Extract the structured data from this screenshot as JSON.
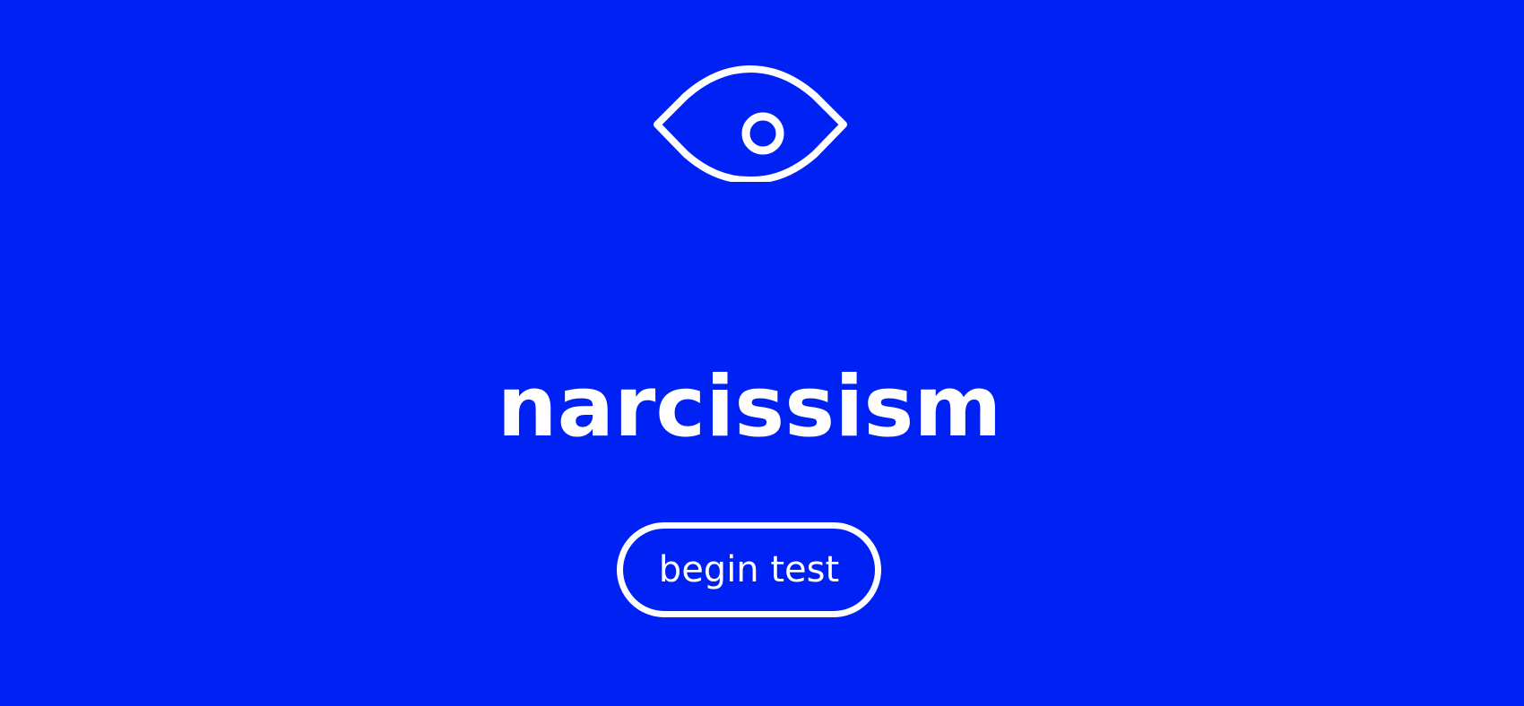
{
  "page": {
    "background_color": "#0021F3",
    "foreground_color": "#FFFFFF"
  },
  "hero": {
    "icon": "eye-icon",
    "title": "narcissism"
  },
  "actions": {
    "begin_label": "begin test"
  }
}
